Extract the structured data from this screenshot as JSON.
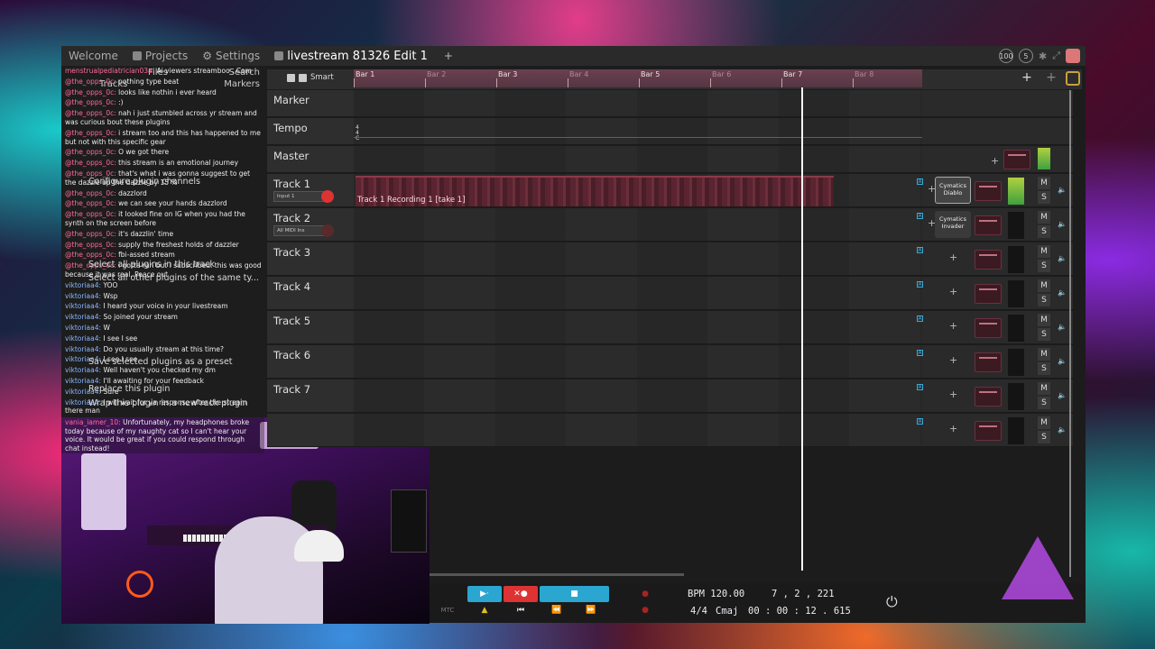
{
  "app": {
    "tabs": [
      {
        "label": "Welcome"
      },
      {
        "label": "Projects"
      },
      {
        "label": "Settings"
      },
      {
        "label": "livestream 81326 Edit 1"
      }
    ],
    "new_tab": "+",
    "top_right": {
      "badge_100": "100",
      "badge_5": "5"
    }
  },
  "left_panel": {
    "headers": [
      "Files",
      "Search",
      "Tracks",
      "Markers"
    ],
    "menu_items": [
      "Configure plugin channels",
      "Select all plugins in this track",
      "Select all other plugins of the same ty...",
      "Save selected plugins as a preset",
      "Replace this plugin",
      "Wrap this plugin in a new rack plugin"
    ],
    "chat": [
      {
        "user": "menstrualpediatrician03a:",
        "msg": "Ai viewers streamboo . Com"
      },
      {
        "user": "@the_opps_0c:",
        "msg": "nothing type beat"
      },
      {
        "user": "@the_opps_0c:",
        "msg": "looks like nothin i ever heard"
      },
      {
        "user": "@the_opps_0c:",
        "msg": ":)"
      },
      {
        "user": "@the_opps_0c:",
        "msg": "nah i just stumbled across yr stream and was curious bout these plugins"
      },
      {
        "user": "@the_opps_0c:",
        "msg": "i stream too and this has happened to me but not with this specific gear"
      },
      {
        "user": "@the_opps_0c:",
        "msg": "O we got there"
      },
      {
        "user": "@the_opps_0c:",
        "msg": "this stream is an emotional journey"
      },
      {
        "user": "@the_opps_0c:",
        "msg": "that's what i was gonna suggest to get the dazzle up the dazzle by 15 %"
      },
      {
        "user": "@the_opps_0c:",
        "msg": "dazzlord"
      },
      {
        "user": "@the_opps_0c:",
        "msg": "we can see your hands dazzlord"
      },
      {
        "user": "@the_opps_0c:",
        "msg": "it looked fine on IG when you had the synth on the screen before"
      },
      {
        "user": "@the_opps_0c:",
        "msg": "it's dazzlin' time"
      },
      {
        "user": "@the_opps_0c:",
        "msg": "supply the freshest holds of dazzler"
      },
      {
        "user": "@the_opps_0c:",
        "msg": "fbi-assed stream"
      },
      {
        "user": "@the_opps_0c:",
        "msg": "i gotta run but I subscribed. this was good because it was real. Peace out"
      },
      {
        "user": "viktoriaa4:",
        "msg": "YOO"
      },
      {
        "user": "viktoriaa4:",
        "msg": "Wsp"
      },
      {
        "user": "viktoriaa4:",
        "msg": "I heard your voice in your livestream"
      },
      {
        "user": "viktoriaa4:",
        "msg": "So joined your stream"
      },
      {
        "user": "viktoriaa4:",
        "msg": "W"
      },
      {
        "user": "viktoriaa4:",
        "msg": "I see I see"
      },
      {
        "user": "viktoriaa4:",
        "msg": "Do you usually stream at this time?"
      },
      {
        "user": "viktoriaa4:",
        "msg": "I see I see"
      },
      {
        "user": "viktoriaa4:",
        "msg": "Well haven't you checked my dm"
      },
      {
        "user": "viktoriaa4:",
        "msg": "I'll awaiting for your feedback"
      },
      {
        "user": "viktoriaa4:",
        "msg": "Sure"
      },
      {
        "user": "viktoriaa4:",
        "msg": "I will wait for ya response after the stream there man"
      }
    ],
    "webcam_chat": [
      {
        "user": "vania_iamer_10:",
        "msg": "Unfortunately, my headphones broke today because of my naughty cat so I can't hear your voice. It would be great if you could respond through chat instead!"
      }
    ]
  },
  "toolbar": {
    "smart_label": "Smart"
  },
  "ruler": {
    "bars": [
      {
        "label": "Bar 1",
        "dim": false
      },
      {
        "label": "Bar 2",
        "dim": true
      },
      {
        "label": "Bar 3",
        "dim": false
      },
      {
        "label": "Bar 4",
        "dim": true
      },
      {
        "label": "Bar 5",
        "dim": false
      },
      {
        "label": "Bar 6",
        "dim": true
      },
      {
        "label": "Bar 7",
        "dim": false
      },
      {
        "label": "Bar 8",
        "dim": true
      }
    ]
  },
  "tracks": {
    "marker": "Marker",
    "tempo": "Tempo",
    "tempo_sig": [
      "4",
      "4",
      "C"
    ],
    "master": "Master",
    "rows": [
      {
        "name": "Track 1",
        "input": "Input 1",
        "armed": true,
        "clip": "Track 1 Recording 1 [take 1]",
        "plugin": "Cymatics Diablo",
        "meter_active": true,
        "selected_plugin": true
      },
      {
        "name": "Track 2",
        "input": "All MIDI Ins",
        "armed": false,
        "clip": "",
        "plugin": "Cymatics Invader",
        "meter_active": false,
        "selected_plugin": false
      },
      {
        "name": "Track 3",
        "input": "",
        "armed": false,
        "clip": "",
        "plugin": "",
        "meter_active": false,
        "selected_plugin": false
      },
      {
        "name": "Track 4",
        "input": "",
        "armed": false,
        "clip": "",
        "plugin": "",
        "meter_active": false,
        "selected_plugin": false
      },
      {
        "name": "Track 5",
        "input": "",
        "armed": false,
        "clip": "",
        "plugin": "",
        "meter_active": false,
        "selected_plugin": false
      },
      {
        "name": "Track 6",
        "input": "",
        "armed": false,
        "clip": "",
        "plugin": "",
        "meter_active": false,
        "selected_plugin": false
      },
      {
        "name": "Track 7",
        "input": "",
        "armed": false,
        "clip": "",
        "plugin": "",
        "meter_active": false,
        "selected_plugin": false
      },
      {
        "name": "",
        "input": "",
        "armed": false,
        "clip": "",
        "plugin": "",
        "meter_active": false,
        "selected_plugin": false
      }
    ],
    "mute_label": "M",
    "solo_label": "S"
  },
  "transport": {
    "mtc": "MTC",
    "bpm": "BPM 120.00",
    "position": "7 , 2 , 221",
    "time_sig": "4/4",
    "key": "Cmaj",
    "timecode": "00 : 00 : 12 . 615"
  },
  "colors": {
    "accent_cyan": "#2aa6d0",
    "record_red": "#d33333",
    "ruler": "#6a4050"
  }
}
